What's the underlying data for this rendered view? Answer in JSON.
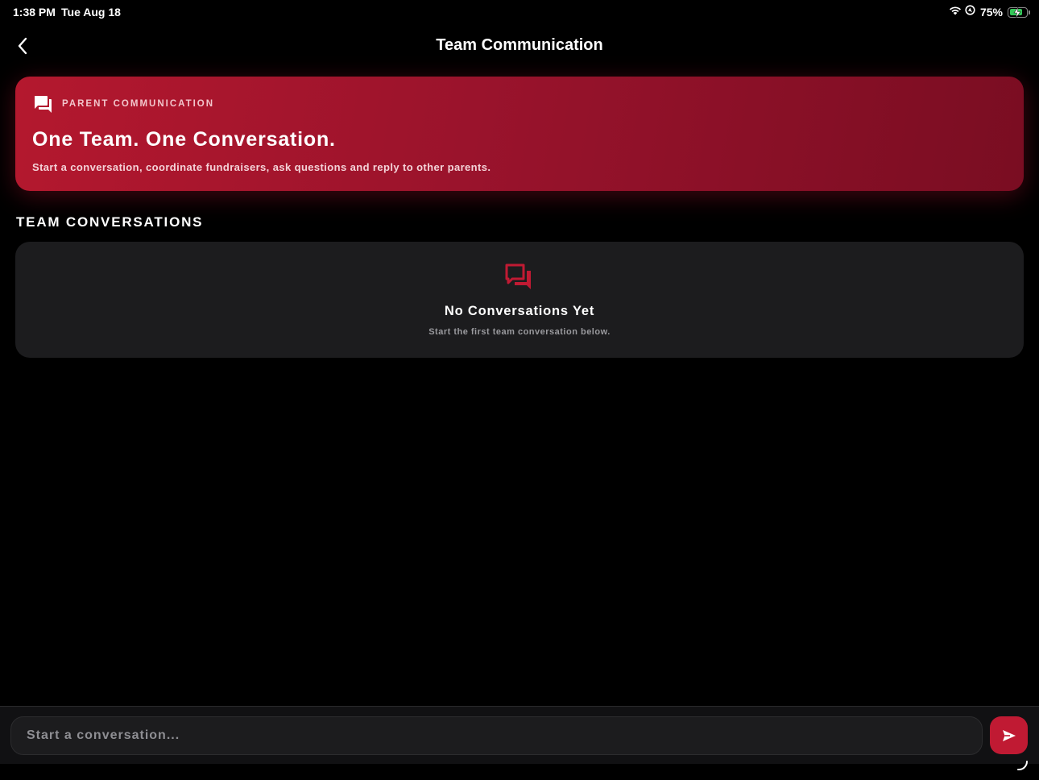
{
  "status_bar": {
    "time": "1:38 PM",
    "date": "Tue Aug 18",
    "battery_percent": "75%",
    "battery_level": 0.75,
    "icons": [
      "wifi-icon",
      "location-icon",
      "battery-icon"
    ]
  },
  "nav": {
    "title": "Team Communication",
    "back_icon": "chevron-left-icon"
  },
  "hero": {
    "eyebrow": "PARENT COMMUNICATION",
    "title": "One Team. One Conversation.",
    "subtitle": "Start a conversation, coordinate fundraisers, ask questions and reply to other parents.",
    "icon": "chat-bubble-icon"
  },
  "conversations": {
    "section_title": "TEAM CONVERSATIONS",
    "empty_title": "No Conversations Yet",
    "empty_subtitle": "Start the first team conversation below.",
    "empty_icon": "chat-bubbles-icon",
    "items": []
  },
  "composer": {
    "placeholder": "Start a conversation...",
    "value": "",
    "send_icon": "send-icon"
  },
  "colors": {
    "accent": "#c01a33",
    "background": "#000000",
    "card": "#1c1c1e",
    "battery": "#34c759"
  }
}
